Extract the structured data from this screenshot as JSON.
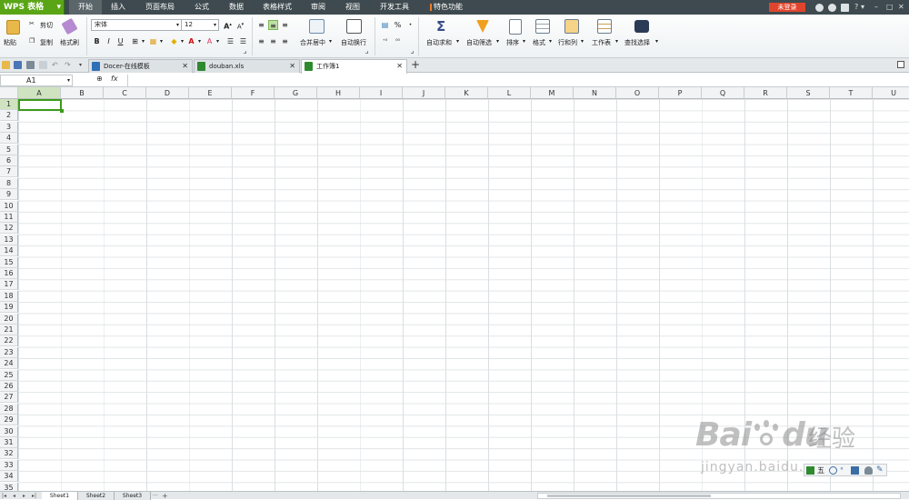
{
  "app": {
    "name": "WPS 表格"
  },
  "menu_tabs": [
    "开始",
    "插入",
    "页面布局",
    "公式",
    "数据",
    "表格样式",
    "审阅",
    "视图",
    "开发工具",
    "特色功能"
  ],
  "login_label": "未登录",
  "help_label": "?",
  "ribbon": {
    "paste": "粘贴",
    "cut": "剪切",
    "copy": "复制",
    "format_painter": "格式刷",
    "font_name": "宋体",
    "font_size": "12",
    "bold": "B",
    "italic": "I",
    "underline": "U",
    "merge_center": "合并居中",
    "wrap_text": "自动换行",
    "percent": "%",
    "autosum": "自动求和",
    "autofilter": "自动筛选",
    "sort": "排序",
    "format": "格式",
    "rows_cols": "行和列",
    "worksheet": "工作表",
    "find_select": "查找选择"
  },
  "doc_tabs": [
    {
      "label": "Docer-在线模板",
      "color": "#2f6fb5"
    },
    {
      "label": "douban.xls",
      "color": "#2f8a2f"
    },
    {
      "label": "工作簿1",
      "color": "#2f8a2f"
    }
  ],
  "formula_bar": {
    "cell_ref": "A1",
    "fx": "fx"
  },
  "columns": [
    "A",
    "B",
    "C",
    "D",
    "E",
    "F",
    "G",
    "H",
    "I",
    "J",
    "K",
    "L",
    "M",
    "N",
    "O",
    "P",
    "Q",
    "R",
    "S",
    "T",
    "U"
  ],
  "rows": [
    "1",
    "2",
    "3",
    "4",
    "5",
    "6",
    "7",
    "8",
    "9",
    "10",
    "11",
    "12",
    "13",
    "14",
    "15",
    "16",
    "17",
    "18",
    "19",
    "20",
    "21",
    "22",
    "23",
    "24",
    "25",
    "26",
    "27",
    "28",
    "29",
    "30",
    "31",
    "32",
    "33",
    "34",
    "35"
  ],
  "sheets": [
    "Sheet1",
    "Sheet2",
    "Sheet3"
  ],
  "watermark": {
    "brand": "Bai",
    "brand2": "du",
    "cn": "经验",
    "url": "jingyan.baidu.com"
  },
  "status_icons": [
    "五"
  ],
  "colors": {
    "accent": "#5aa516",
    "titlebar": "#3e4a4f",
    "login": "#e0442c",
    "selection": "#3c9a1b"
  }
}
